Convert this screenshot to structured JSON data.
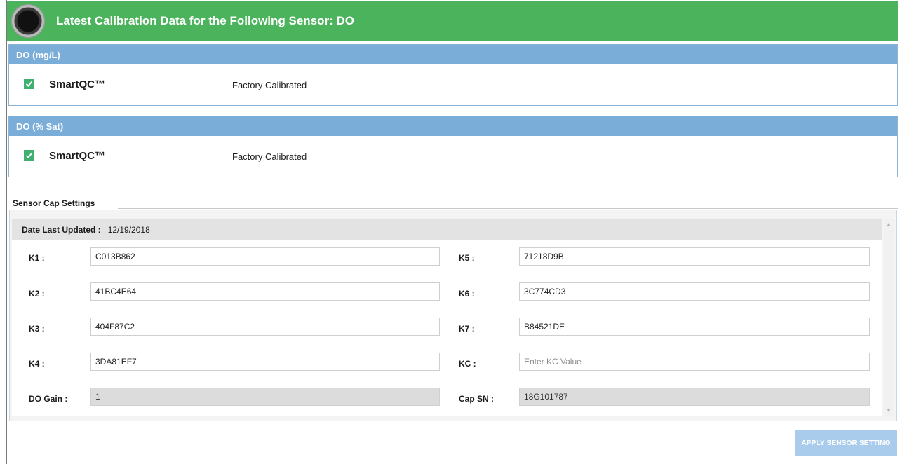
{
  "header": {
    "title": "Latest Calibration Data for the Following Sensor:  DO",
    "icon": "sensor-icon",
    "background_color": "#4cb35d"
  },
  "sections": [
    {
      "title": "DO (mg/L)",
      "method": "SmartQC™",
      "status": "Factory Calibrated",
      "checked": true
    },
    {
      "title": "DO (% Sat)",
      "method": "SmartQC™",
      "status": "Factory Calibrated",
      "checked": true
    }
  ],
  "sensor_cap": {
    "title": "Sensor Cap Settings",
    "date_label": "Date Last Updated :",
    "date_value": "12/19/2018",
    "left_fields": [
      {
        "label": "K1 :",
        "value": "C013B862"
      },
      {
        "label": "K2 :",
        "value": "41BC4E64"
      },
      {
        "label": "K3 :",
        "value": "404F87C2"
      },
      {
        "label": "K4 :",
        "value": "3DA81EF7"
      },
      {
        "label": "DO Gain :",
        "value": "1",
        "readonly": true
      }
    ],
    "right_fields": [
      {
        "label": "K5 :",
        "value": "71218D9B"
      },
      {
        "label": "K6 :",
        "value": "3C774CD3"
      },
      {
        "label": "K7 :",
        "value": "B84521DE"
      },
      {
        "label": "KC :",
        "value": "",
        "placeholder": "Enter KC Value"
      },
      {
        "label": "Cap SN :",
        "value": "18G101787",
        "readonly": true
      }
    ]
  },
  "apply_button": {
    "label": "APPLY SENSOR SETTING",
    "color": "#a9ccec"
  },
  "colors": {
    "section_header": "#7aaed9",
    "check": "#3fb070"
  }
}
